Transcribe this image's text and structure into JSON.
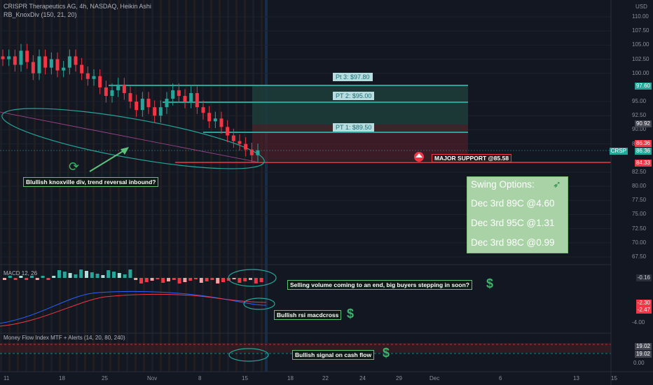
{
  "header": {
    "symbol_line": "CRISPR Therapeutics AG, 4h, NASDAQ, Heikin Ashi",
    "indicator_line": "RB_KnoxDiv (150, 21, 20)"
  },
  "price_axis": {
    "currency": "USD",
    "ticks": [
      "110.00",
      "107.50",
      "105.00",
      "102.50",
      "100.00",
      "95.00",
      "92.50",
      "90.00",
      "87.50",
      "82.50",
      "80.00",
      "77.50",
      "75.00",
      "72.50",
      "70.00",
      "67.50"
    ],
    "tags": [
      {
        "text": "97.60",
        "color": "#26a69a"
      },
      {
        "text": "90.92",
        "color": "#434651"
      },
      {
        "text": "86.36",
        "color": "#f23645"
      },
      {
        "text": "86.36",
        "color": "#26a69a"
      },
      {
        "text": "84.33",
        "color": "#f23645"
      }
    ],
    "symbol_tag": "CRSP"
  },
  "macd_axis": {
    "label": "MACD 12, 26",
    "ticks": [
      "-4.00"
    ],
    "tags": [
      "-0.16",
      "-2.30",
      "-2.47"
    ]
  },
  "mfi": {
    "label": "Money Flow Index MTF + Alerts (14, 20, 80, 240)",
    "ticks": [
      "0.00"
    ],
    "tags": [
      "19.02",
      "19.02"
    ]
  },
  "time_axis": [
    "11",
    "18",
    "25",
    "Nov",
    "8",
    "15",
    "18",
    "22",
    "24",
    "29",
    "Dec",
    "6",
    "13",
    "15"
  ],
  "annotations": {
    "pt3": "Pt 3: $97.80",
    "pt2": "PT 2: $95.00",
    "pt1": "PT 1: $89.50",
    "major_support": "MAJOR SUPPORT @85.58",
    "knox": "Blullish knoxville div, trend reversal inbound?",
    "selling": "Selling volume coming to an end, big buyers stepping in soon?",
    "rsi_cross": "Bullish rsi macdcross",
    "cash_flow": "Bullish signal on cash flow",
    "dollar": "$"
  },
  "swing": {
    "title": "Swing Options:",
    "lines": [
      "Dec 3rd 89C @4.60",
      "Dec 3rd 95C @1.31",
      "Dec 3rd 98C @0.99"
    ]
  },
  "colors": {
    "bull": "#26a69a",
    "bear": "#f23645",
    "accent": "#3bb46a"
  },
  "chart_data": {
    "type": "candlestick",
    "style": "Heikin Ashi",
    "interval": "4h",
    "ylim": [
      65,
      112
    ],
    "ha_close_path": [
      102.5,
      103,
      101.5,
      104,
      102,
      100,
      103,
      101,
      102.5,
      100.5,
      101,
      103,
      101.5,
      100,
      99,
      99.5,
      97.5,
      96,
      97,
      98,
      96.5,
      95,
      93.5,
      95.5,
      94,
      92.5,
      94,
      95.5,
      97,
      96,
      95,
      96.5,
      94,
      93,
      91.5,
      92,
      90.5,
      89,
      88,
      87.5,
      86.5,
      85.5,
      86.36
    ]
  }
}
